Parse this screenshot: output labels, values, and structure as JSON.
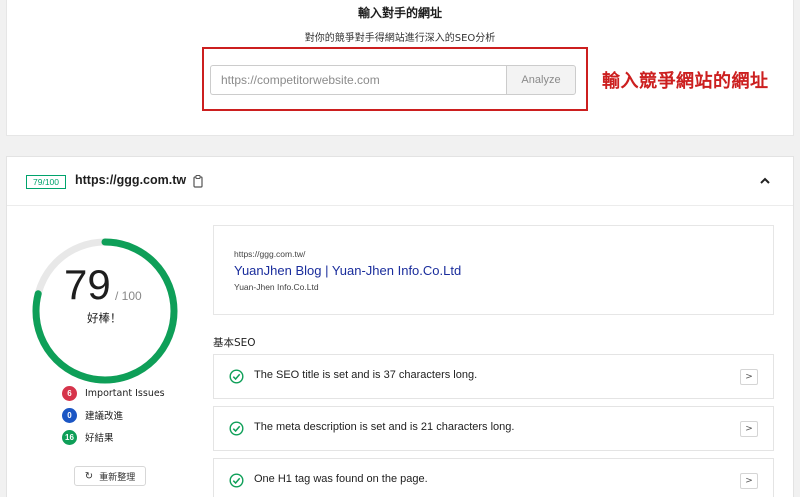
{
  "analyzer": {
    "title": "輸入對手的網址",
    "subtitle": "對你的競爭對手得網站進行深入的SEO分析",
    "input_placeholder": "https://competitorwebsite.com",
    "analyze_label": "Analyze",
    "annotation": "輸入競爭網站的網址"
  },
  "report": {
    "badge": "79/100",
    "site": "https://ggg.com.tw",
    "score": "79",
    "score_max": "/ 100",
    "verdict": "好棒！",
    "legend": [
      {
        "count": "6",
        "label": "Important Issues",
        "color": "#d6344b"
      },
      {
        "count": "0",
        "label": "建議改進",
        "color": "#1b56c4"
      },
      {
        "count": "16",
        "label": "好結果",
        "color": "#0e9f58"
      }
    ],
    "refresh_label": "重新整理",
    "preview": {
      "url": "https://ggg.com.tw/",
      "title": "YuanJhen Blog | Yuan-Jhen Info.Co.Ltd",
      "description": "Yuan-Jhen Info.Co.Ltd"
    },
    "section_title": "基本SEO",
    "checks": [
      {
        "text": "The SEO title is set and is 37 characters long."
      },
      {
        "text": "The meta description is set and is 21 characters long."
      },
      {
        "text": "One H1 tag was found on the page."
      }
    ],
    "score_ratio": 0.79,
    "colors": {
      "accent": "#0e9f58",
      "ring_bg": "#e8e8e8",
      "annotation": "#cc1f1f",
      "link": "#1a2d9c"
    }
  }
}
